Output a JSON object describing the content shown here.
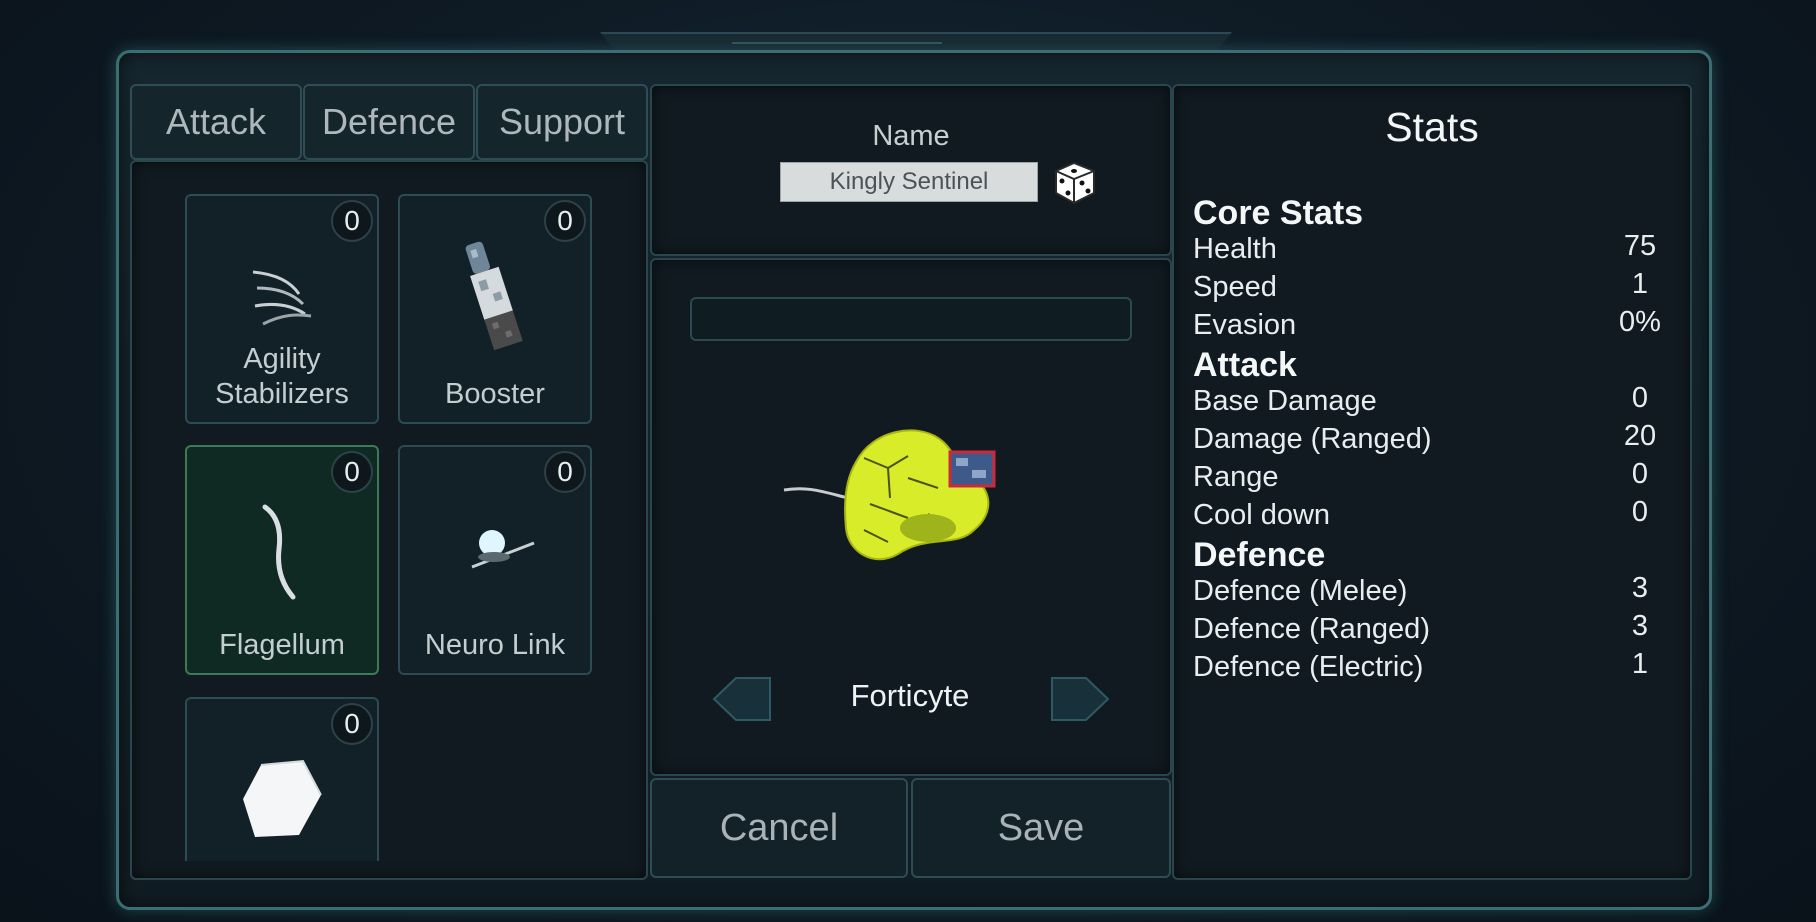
{
  "tabs": [
    "Attack",
    "Defence",
    "Support"
  ],
  "parts": [
    {
      "label": "Agility Stabilizers",
      "count": "0",
      "icon": "claws-icon"
    },
    {
      "label": "Booster",
      "count": "0",
      "icon": "booster-icon"
    },
    {
      "label": "Flagellum",
      "count": "0",
      "icon": "flagellum-icon",
      "selected": true
    },
    {
      "label": "Neuro Link",
      "count": "0",
      "icon": "neuro-link-icon"
    },
    {
      "label": "",
      "count": "0",
      "icon": "cube-icon"
    }
  ],
  "name": {
    "label": "Name",
    "value": "Kingly Sentinel"
  },
  "species": "Forticyte",
  "buttons": {
    "cancel": "Cancel",
    "save": "Save"
  },
  "stats": {
    "title": "Stats",
    "sections": [
      {
        "heading": "Core Stats",
        "rows": [
          {
            "label": "Health",
            "value": "75"
          },
          {
            "label": "Speed",
            "value": "1"
          },
          {
            "label": "Evasion",
            "value": "0%"
          }
        ]
      },
      {
        "heading": "Attack",
        "rows": [
          {
            "label": "Base Damage",
            "value": "0"
          },
          {
            "label": "Damage (Ranged)",
            "value": "20"
          },
          {
            "label": "Range",
            "value": "0"
          },
          {
            "label": "Cool down",
            "value": "0"
          }
        ]
      },
      {
        "heading": "Defence",
        "rows": [
          {
            "label": "Defence (Melee)",
            "value": "3"
          },
          {
            "label": "Defence (Ranged)",
            "value": "3"
          },
          {
            "label": "Defence (Electric)",
            "value": "1"
          }
        ]
      }
    ]
  },
  "colors": {
    "accent": "#3a6e73",
    "creature": "#d8ec2a",
    "selected_card": "#0f2a22"
  }
}
